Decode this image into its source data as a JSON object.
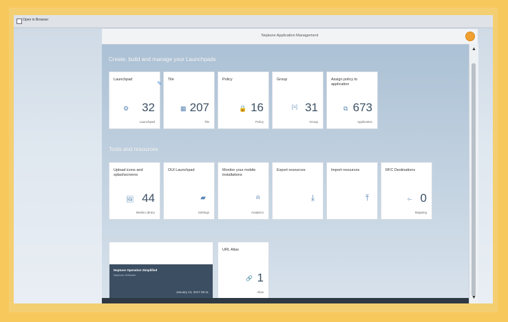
{
  "browser": {
    "checkbox_label": "Open in Browser"
  },
  "app": {
    "title": "Neptune Application Management"
  },
  "sections": {
    "manage": "Create, build and manage your Launchpads",
    "tools": "Tools and resources"
  },
  "manage_tiles": [
    {
      "title": "Launchpad",
      "count": "32",
      "footer": "Launchpad",
      "icon": "cube-icon",
      "glyph": "⚙"
    },
    {
      "title": "Tile",
      "count": "207",
      "footer": "Tile",
      "icon": "grid-icon",
      "glyph": "▦"
    },
    {
      "title": "Policy",
      "count": "16",
      "footer": "Policy",
      "icon": "lock-icon",
      "glyph": "🔒"
    },
    {
      "title": "Group",
      "count": "31",
      "footer": "Group",
      "icon": "group-icon",
      "glyph": "[=]"
    },
    {
      "title": "Assign policy to application",
      "count": "673",
      "footer": "Application",
      "icon": "assign-icon",
      "glyph": "⧉"
    }
  ],
  "tool_tiles": [
    {
      "title": "Upload icons and splashscreens",
      "count": "44",
      "footer": "Media Library",
      "icon": "image-icon",
      "glyph": "🖼"
    },
    {
      "title": "OUI Launchpad",
      "count": "",
      "footer": "Settings",
      "icon": "folder-icon",
      "glyph": "▰"
    },
    {
      "title": "Monitor your mobile installations",
      "count": "",
      "footer": "Analytics",
      "icon": "bar-chart-icon",
      "glyph": "ılı"
    },
    {
      "title": "Export resources",
      "count": "",
      "footer": "",
      "icon": "download-icon",
      "glyph": "⤓"
    },
    {
      "title": "Import resources",
      "count": "",
      "footer": "",
      "icon": "upload-icon",
      "glyph": "⤒"
    },
    {
      "title": "RFC Destinations",
      "count": "0",
      "footer": "Mapping",
      "icon": "link-icon",
      "glyph": "⟜"
    }
  ],
  "news": {
    "title": "Neptune Operation Simplified",
    "subtitle": "Neptune-Software",
    "date": "January 13, 2017 06:11"
  },
  "url_alias": {
    "title": "URL Alias",
    "count": "1",
    "footer": "Alias",
    "icon": "link-icon",
    "glyph": "🔗"
  },
  "colors": {
    "accent": "#f0a030",
    "tile_icon": "#5a86b4",
    "frame": "#f7c85c"
  }
}
